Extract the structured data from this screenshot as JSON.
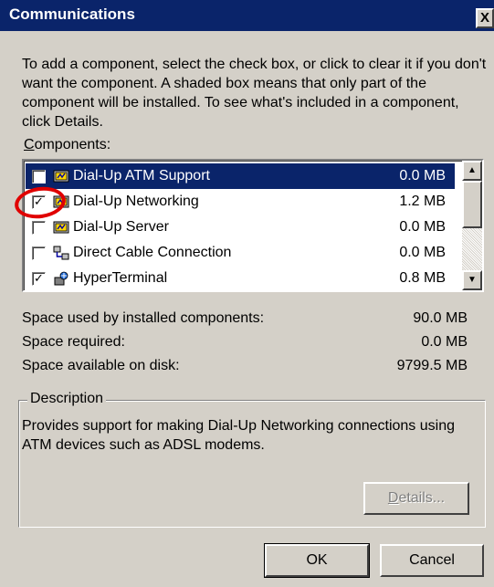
{
  "window": {
    "title": "Communications",
    "close_glyph": "X"
  },
  "intro_text": "To add a component, select the check box, or click to clear it if you don't want the component. A shaded box means that only part of the component will be installed. To see what's included in a component, click Details.",
  "components": {
    "label_accel": "C",
    "label_rest": "omponents:",
    "items": [
      {
        "name": "Dial-Up ATM Support",
        "size": "0.0 MB",
        "checked": false,
        "selected": true,
        "icon": "dialup-icon"
      },
      {
        "name": "Dial-Up Networking",
        "size": "1.2 MB",
        "checked": true,
        "selected": false,
        "icon": "dialup-icon"
      },
      {
        "name": "Dial-Up Server",
        "size": "0.0 MB",
        "checked": false,
        "selected": false,
        "icon": "dialup-icon"
      },
      {
        "name": "Direct Cable Connection",
        "size": "0.0 MB",
        "checked": false,
        "selected": false,
        "icon": "cable-connection-icon"
      },
      {
        "name": "HyperTerminal",
        "size": "0.8 MB",
        "checked": true,
        "selected": false,
        "icon": "hyperterminal-icon"
      }
    ]
  },
  "space": {
    "used_label": "Space used by installed components:",
    "used_value": "90.0 MB",
    "required_label": "Space required:",
    "required_value": "0.0 MB",
    "available_label": "Space available on disk:",
    "available_value": "9799.5 MB"
  },
  "description": {
    "label": "Description",
    "text": "Provides support for making Dial-Up Networking connections using ATM devices such as ADSL modems."
  },
  "buttons": {
    "details_accel": "D",
    "details_rest": "etails...",
    "ok": "OK",
    "cancel": "Cancel"
  },
  "colors": {
    "dialog_bg": "#d4d0c8",
    "titlebar": "#0a246a",
    "selection": "#0a246a",
    "annotation": "#e00000"
  }
}
